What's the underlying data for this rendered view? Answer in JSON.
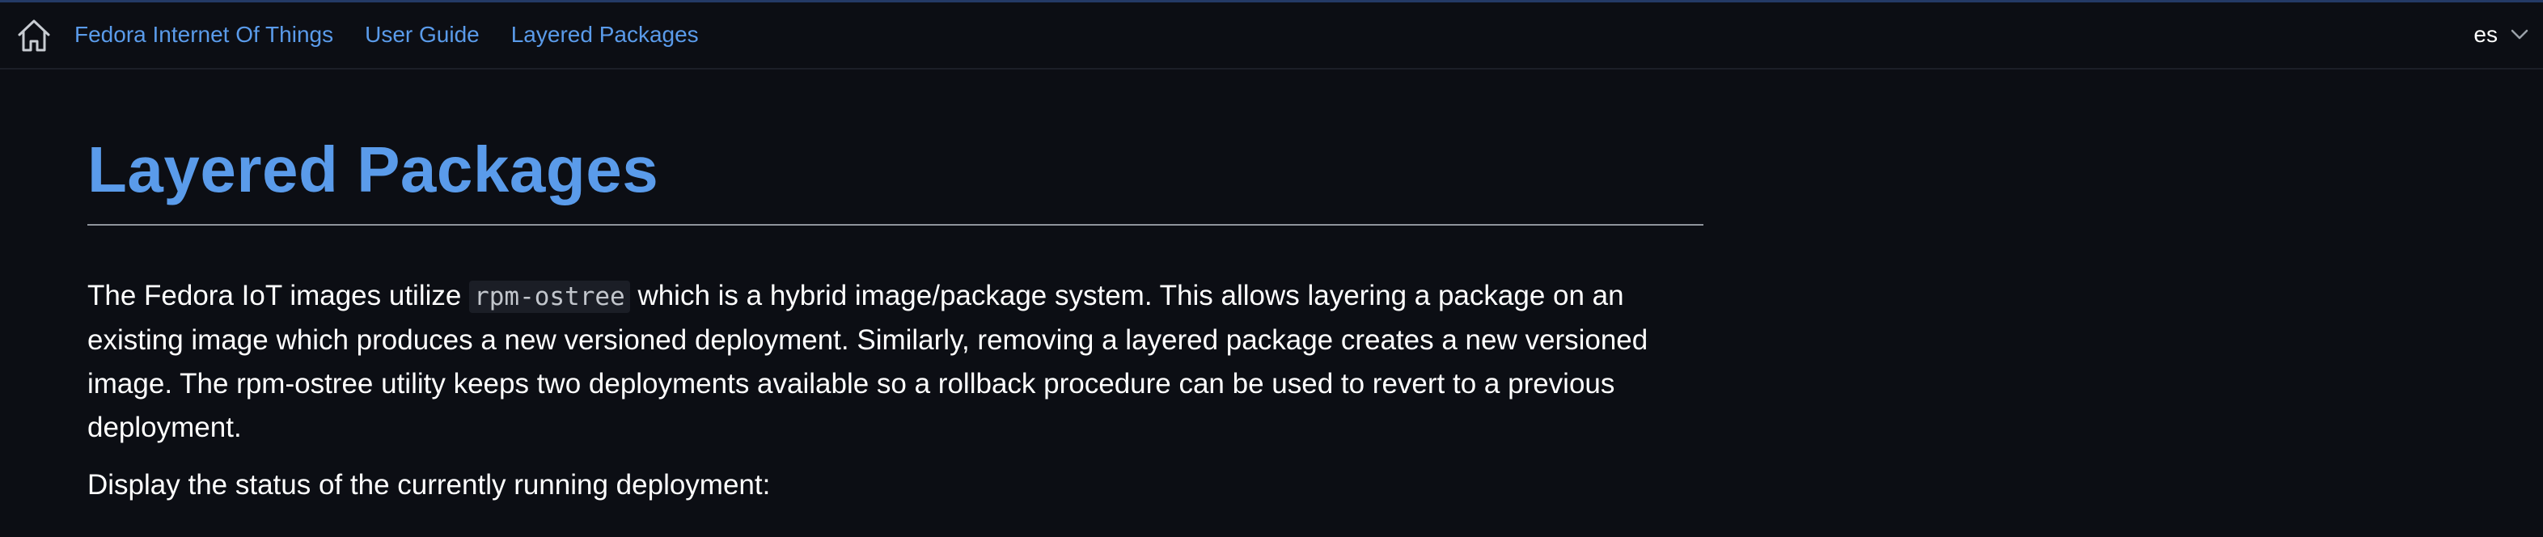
{
  "nav": {
    "breadcrumbs": [
      {
        "label": "Fedora Internet Of Things"
      },
      {
        "label": "User Guide"
      },
      {
        "label": "Layered Packages"
      }
    ],
    "language": "es",
    "home_icon": "home-icon",
    "language_icon": "chevron-down-icon"
  },
  "page": {
    "title": "Layered Packages",
    "intro_before_code": "The Fedora IoT images utilize ",
    "intro_code": "rpm-ostree",
    "intro_after_code": " which is a hybrid image/package system. This allows layering a package on an existing image which produces a new versioned deployment. Similarly, removing a layered package creates a new versioned image. The rpm-ostree utility keeps two deployments available so a rollback procedure can be used to revert to a previous deployment.",
    "status_text": "Display the status of the currently running deployment:"
  },
  "colors": {
    "background": "#0c0e14",
    "link": "#5a9bea",
    "title": "#5a9bea",
    "text": "#ffffff",
    "code_bg": "#1b1e26"
  }
}
